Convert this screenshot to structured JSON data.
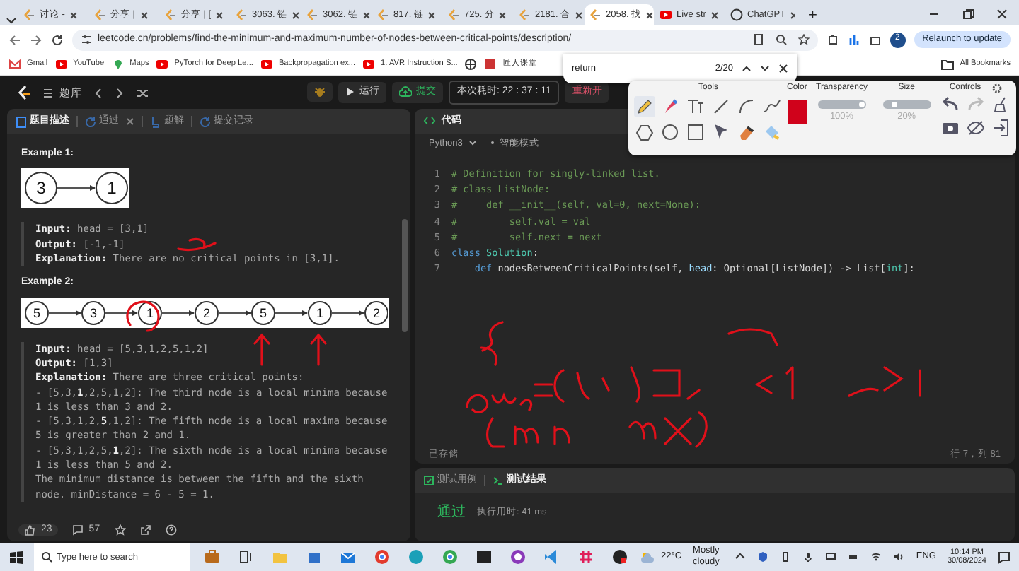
{
  "browser": {
    "tabs": [
      {
        "label": "讨论 -",
        "kind": "leetcode",
        "selected": false
      },
      {
        "label": "分享 |",
        "kind": "leetcode",
        "selected": false
      },
      {
        "label": "分享 | [",
        "kind": "leetcode",
        "selected": false
      },
      {
        "label": "3063. 链",
        "kind": "leetcode",
        "selected": false
      },
      {
        "label": "3062. 链",
        "kind": "leetcode",
        "selected": false
      },
      {
        "label": "817. 链",
        "kind": "leetcode",
        "selected": false
      },
      {
        "label": "725. 分",
        "kind": "leetcode",
        "selected": false
      },
      {
        "label": "2181. 合",
        "kind": "leetcode",
        "selected": false
      },
      {
        "label": "2058. 找",
        "kind": "leetcode",
        "selected": true
      },
      {
        "label": "Live str",
        "kind": "video",
        "selected": false
      },
      {
        "label": "ChatGPT",
        "kind": "chat",
        "selected": false
      }
    ],
    "new_tab": "+",
    "url": "leetcode.cn/problems/find-the-minimum-and-maximum-number-of-nodes-between-critical-points/description/",
    "profile": "2",
    "relaunch": "Relaunch to update",
    "bookmarks": [
      {
        "label": "Gmail",
        "kind": "mail"
      },
      {
        "label": "YouTube",
        "kind": "video"
      },
      {
        "label": "Maps",
        "kind": "map"
      },
      {
        "label": "PyTorch for Deep Le...",
        "kind": "video"
      },
      {
        "label": "Backpropagation ex...",
        "kind": "video"
      },
      {
        "label": "1. AVR Instruction S...",
        "kind": "video"
      },
      {
        "kind": "globe"
      },
      {
        "label": "匠人课堂",
        "kind": "site"
      }
    ],
    "all_bookmarks": "All Bookmarks"
  },
  "find_bar": {
    "query": "return",
    "count": "2/20"
  },
  "app_header": {
    "problem_list": "题库",
    "run": "运行",
    "submit": "提交",
    "timer": "本次耗时: 22 : 37 : 11",
    "restart": "重新开"
  },
  "description_tabs": [
    {
      "label": "题目描述",
      "selected": true
    },
    {
      "label": "通过",
      "selected": false
    },
    {
      "label": "题解",
      "selected": false
    },
    {
      "label": "提交记录",
      "selected": false
    }
  ],
  "examples": [
    {
      "title": "Example 1:",
      "nodes": [
        "3",
        "1"
      ],
      "lines": [
        {
          "label": "Input:",
          "text": "head = [3,1]"
        },
        {
          "label": "Output:",
          "text": "[-1,-1]"
        },
        {
          "label": "Explanation:",
          "text": "There are no critical points in [3,1]."
        }
      ]
    },
    {
      "title": "Example 2:",
      "nodes": [
        "5",
        "3",
        "1",
        "2",
        "5",
        "1",
        "2"
      ],
      "lines": [
        {
          "label": "Input:",
          "text": "head = [5,3,1,2,5,1,2]"
        },
        {
          "label": "Output:",
          "text": "[1,3]"
        },
        {
          "label": "Explanation:",
          "text": "There are three critical points:"
        }
      ],
      "details": [
        "- [5,3,**1**,2,5,1,2]: The third node is a local minima because 1 is less than 3 and 2.",
        "- [5,3,1,2,**5**,1,2]: The fifth node is a local maxima because 5 is greater than 2 and 1.",
        "- [5,3,1,2,5,**1**,2]: The sixth node is a local minima because 1 is less than 5 and 2.",
        "The minimum distance is between the fifth and the sixth node. minDistance = 6 - 5 = 1."
      ]
    }
  ],
  "footer": {
    "likes": "23",
    "comments": "57"
  },
  "code_panel": {
    "title": "代码",
    "language": "Python3",
    "mode": "智能模式",
    "lines": [
      {
        "number": "1",
        "tokens": [
          {
            "kind": "comment",
            "text": "# Definition for singly-linked list."
          }
        ]
      },
      {
        "number": "2",
        "tokens": [
          {
            "kind": "comment",
            "text": "# class ListNode:"
          }
        ]
      },
      {
        "number": "3",
        "tokens": [
          {
            "kind": "comment",
            "text": "#     def __init__(self, val=0, next=None):"
          }
        ]
      },
      {
        "number": "4",
        "tokens": [
          {
            "kind": "comment",
            "text": "#         self.val = val"
          }
        ]
      },
      {
        "number": "5",
        "tokens": [
          {
            "kind": "comment",
            "text": "#         self.next = next"
          }
        ]
      },
      {
        "number": "6",
        "tokens": [
          {
            "kind": "keyword",
            "text": "class"
          },
          {
            "kind": "type",
            "text": " Solution"
          },
          {
            "kind": "plain",
            "text": ":"
          }
        ]
      },
      {
        "number": "7",
        "tokens": [
          {
            "kind": "keyword",
            "text": "    def"
          },
          {
            "kind": "plain",
            "text": " nodesBetweenCriticalPoints(self, "
          },
          {
            "kind": "param",
            "text": "head"
          },
          {
            "kind": "plain",
            "text": ": Optional[ListNode]) -> List["
          },
          {
            "kind": "type",
            "text": "int"
          },
          {
            "kind": "plain",
            "text": "]:"
          }
        ]
      }
    ],
    "saved": "已存储",
    "cursor": "行 7，列 81"
  },
  "test_panel": {
    "tabs": [
      {
        "label": "测试用例",
        "selected": false
      },
      {
        "label": "测试结果",
        "selected": true
      }
    ],
    "result": "通过",
    "runtime": "执行用时: 41 ms"
  },
  "draw_toolbar": {
    "tools_title": "Tools",
    "color_title": "Color",
    "transparency_title": "Transparency",
    "size_title": "Size",
    "controls_title": "Controls",
    "tools": [
      {
        "kind": "pencil",
        "selected": true
      },
      {
        "kind": "marker",
        "selected": false
      },
      {
        "kind": "text",
        "selected": false
      },
      {
        "kind": "line",
        "selected": false
      },
      {
        "kind": "arc",
        "selected": false
      },
      {
        "kind": "curve",
        "selected": false
      },
      {
        "kind": "polygon",
        "selected": false
      },
      {
        "kind": "circle",
        "selected": false
      },
      {
        "kind": "rect",
        "selected": false
      },
      {
        "kind": "pointer",
        "selected": false
      },
      {
        "kind": "eraser",
        "selected": false
      },
      {
        "kind": "fill",
        "selected": false
      }
    ],
    "transparency": {
      "level": 1.0,
      "reading": "100%"
    },
    "size": {
      "level": 0.2,
      "reading": "20%"
    }
  },
  "taskbar": {
    "search_placeholder": "Type here to search",
    "temperature": "22°C",
    "weather": "Mostly cloudy",
    "language": "ENG",
    "time": "10:14 PM",
    "date": "30/08/2024"
  }
}
